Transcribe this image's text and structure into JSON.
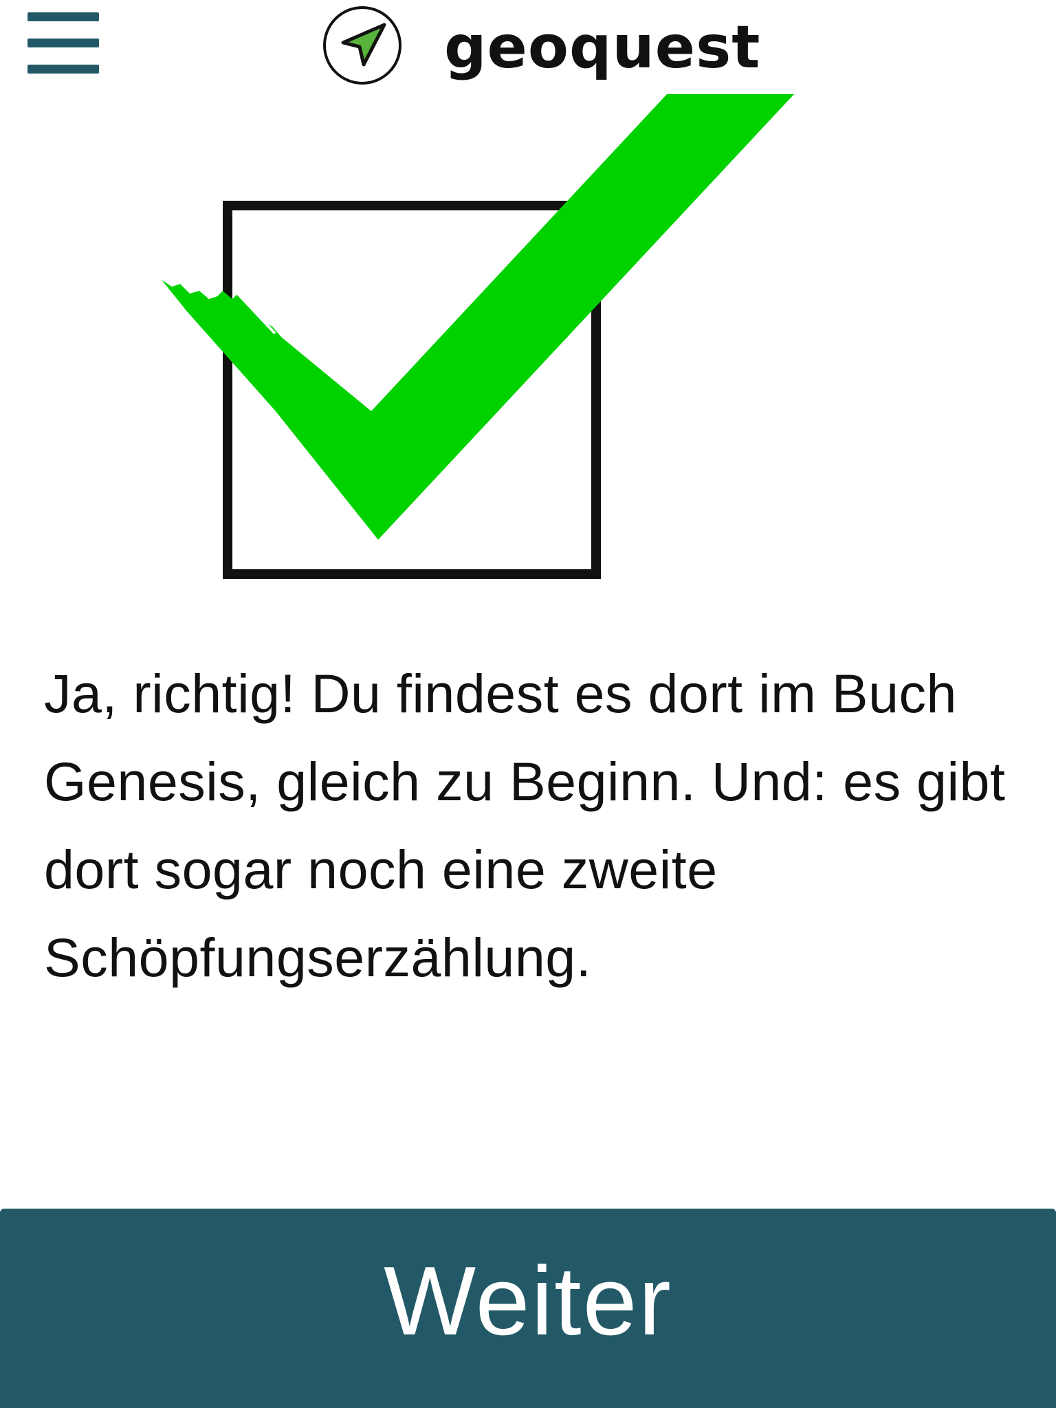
{
  "header": {
    "menu_icon": "hamburger-menu-icon",
    "logo_icon": "navigation-arrow-icon",
    "brand": "geoquest"
  },
  "illustration": {
    "icon": "green-checkmark-in-box-icon",
    "check_color": "#00d200",
    "box_color": "#111111"
  },
  "message": {
    "text": "Ja, richtig! Du findest es dort im Buch Genesis, gleich zu Beginn. Und: es gibt dort sogar noch eine zweite Schöpfungserzählung."
  },
  "footer": {
    "continue_label": "Weiter"
  },
  "colors": {
    "accent": "#235966",
    "logo_arrow": "#57b33b"
  }
}
